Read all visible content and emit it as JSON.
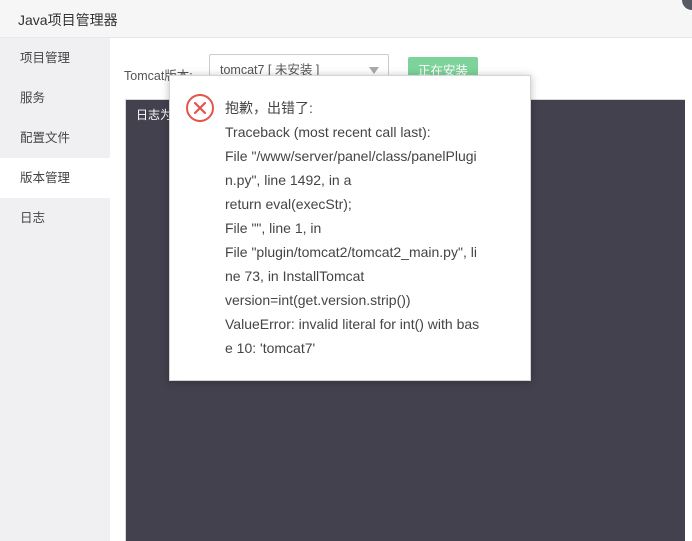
{
  "window": {
    "title": "Java项目管理器"
  },
  "sidebar": {
    "items": [
      {
        "label": "项目管理"
      },
      {
        "label": "服务"
      },
      {
        "label": "配置文件"
      },
      {
        "label": "版本管理"
      },
      {
        "label": "日志"
      }
    ],
    "active_index": 3
  },
  "main": {
    "tomcat_label": "Tomcat版本:",
    "version_select": {
      "value": "tomcat7 [ 未安装 ]"
    },
    "install_button_label": "正在安装",
    "log_text": "日志为"
  },
  "error_dialog": {
    "icon": "error-circle-x-icon",
    "lines": [
      "抱歉，出错了:",
      "Traceback (most recent call last):",
      "File \"/www/server/panel/class/panelPlugi",
      "n.py\", line 1492, in a",
      "return eval(execStr);",
      "File \"\", line 1, in",
      "File \"plugin/tomcat2/tomcat2_main.py\", li",
      "ne 73, in InstallTomcat",
      "version=int(get.version.strip())",
      "ValueError: invalid literal for int() with bas",
      "e 10: 'tomcat7'"
    ]
  },
  "colors": {
    "accent_green": "#7dd39a",
    "log_background": "#43414e",
    "error_red": "#e5534b"
  }
}
